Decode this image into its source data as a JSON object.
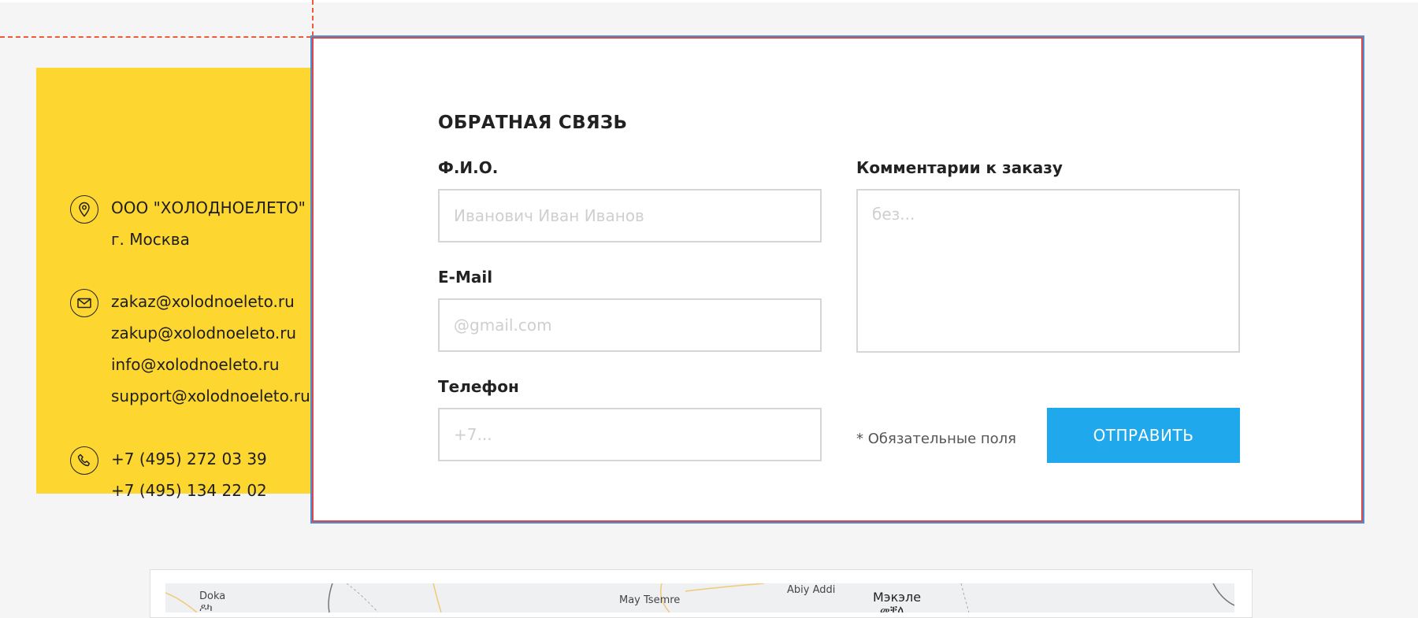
{
  "colors": {
    "background": "#f5f5f5",
    "card": "#fdd630",
    "button": "#1fa9ec",
    "guide": "#ec5c3a",
    "panel_border": "#e0474a"
  },
  "contacts": {
    "address": {
      "icon": "map-pin-icon",
      "lines": [
        "ООО \"ХОЛОДНОЕЛЕТО\"",
        "г. Москва"
      ]
    },
    "emails": {
      "icon": "envelope-icon",
      "lines": [
        "zakaz@xolodnoeleto.ru",
        "zakup@xolodnoeleto.ru",
        "info@xolodnoeleto.ru",
        "support@xolodnoeleto.ru"
      ]
    },
    "phones": {
      "icon": "phone-icon",
      "lines": [
        "+7 (495) 272 03 39",
        "+7 (495) 134 22 02"
      ]
    }
  },
  "form": {
    "title": "ОБРАТНАЯ СВЯЗЬ",
    "name_label": "Ф.И.О.",
    "name_placeholder": "Иванович Иван Иванов",
    "email_label": "E-Mail",
    "email_placeholder": "@gmail.com",
    "phone_label": "Телефон",
    "phone_placeholder": "+7...",
    "comment_label": "Комментарии к заказу",
    "comment_placeholder": "без...",
    "required_note": "* Обязательные поля",
    "submit_label": "ОТПРАВИТЬ"
  },
  "map": {
    "labels": [
      "Doka",
      "ዶካ",
      "May Tsemre",
      "Abiy Addi",
      "Мэкэле",
      "መቐለ"
    ]
  }
}
